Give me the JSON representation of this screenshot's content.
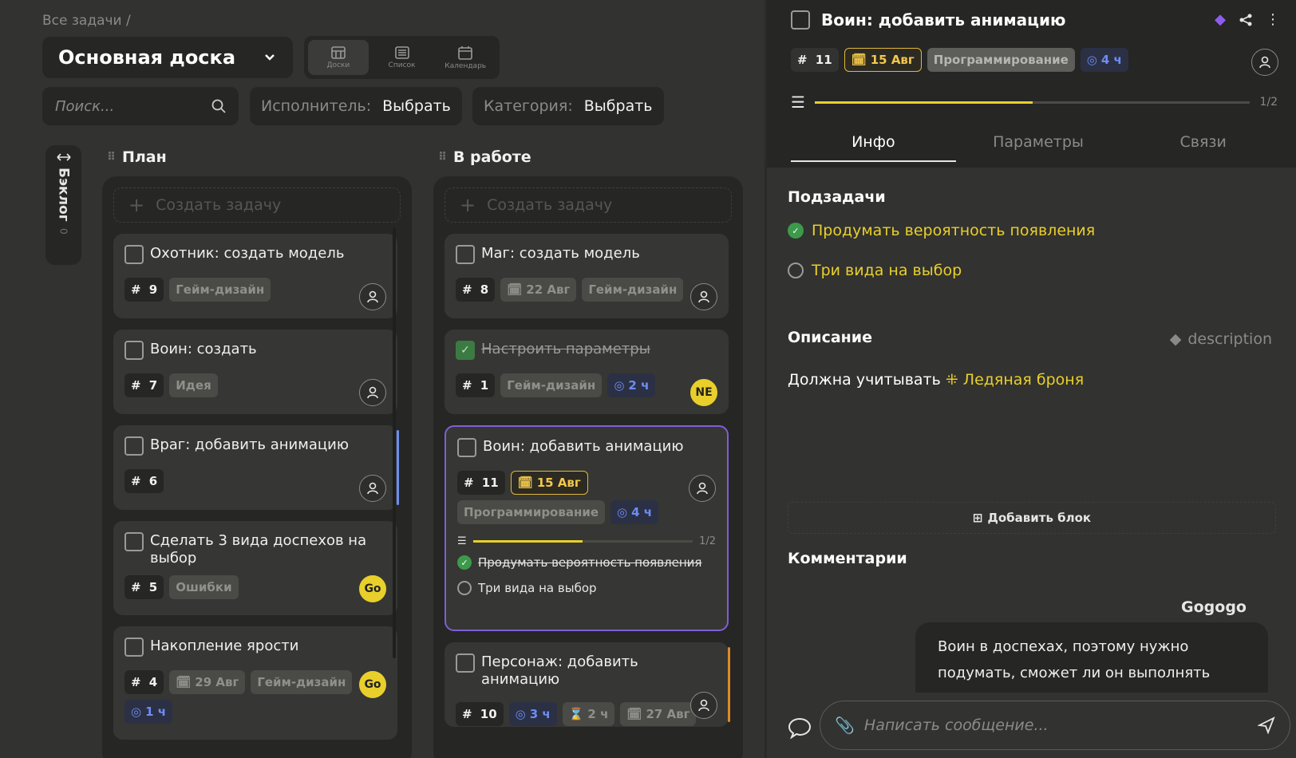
{
  "breadcrumb": "Все задачи /",
  "board": {
    "name": "Основная доска",
    "views": [
      {
        "label": "Доски",
        "icon": "board-icon",
        "active": true
      },
      {
        "label": "Список",
        "icon": "list-icon",
        "active": false
      },
      {
        "label": "Календарь",
        "icon": "calendar-icon",
        "active": false
      }
    ],
    "search_placeholder": "Поиск...",
    "filters": [
      {
        "key": "Исполнитель:",
        "value": "Выбрать"
      },
      {
        "key": "Категория:",
        "value": "Выбрать"
      }
    ],
    "backlog": {
      "label": "Бэклог",
      "count": "0"
    }
  },
  "columns": [
    {
      "title": "План",
      "create_label": "Создать задачу",
      "cards": [
        {
          "title": "Охотник: создать модель",
          "num": "9",
          "tags": [
            "Гейм-дизайн"
          ]
        },
        {
          "title": "Воин: создать",
          "num": "7",
          "tags": [
            "Идея"
          ]
        },
        {
          "title": "Враг: добавить анимацию",
          "num": "6",
          "tags": []
        },
        {
          "title": "Сделать 3 вида доспехов на выбор",
          "num": "5",
          "tags": [
            "Ошибки"
          ],
          "avatar": "Go"
        },
        {
          "title": "Накопление ярости",
          "num": "4",
          "date": "29 Авг",
          "tags": [
            "Гейм-дизайн"
          ],
          "time": "1 ч",
          "avatar": "Go"
        }
      ]
    },
    {
      "title": "В работе",
      "create_label": "Создать задачу",
      "cards": [
        {
          "title": "Маг: создать модель",
          "num": "8",
          "date": "22 Авг",
          "tags": [
            "Гейм-дизайн"
          ]
        },
        {
          "title": "Настроить параметры",
          "num": "1",
          "tags": [
            "Гейм-дизайн"
          ],
          "time": "2 ч",
          "avatar": "NE",
          "done": true
        },
        {
          "title": "Воин: добавить анимацию",
          "num": "11",
          "date": "15 Авг",
          "tags": [
            "Программирование"
          ],
          "time": "4 ч",
          "progress": "1/2",
          "subtasks": [
            {
              "text": "Продумать вероятность появления",
              "done": true
            },
            {
              "text": "Три вида на выбор",
              "done": false
            }
          ]
        },
        {
          "title": "Персонаж: добавить анимацию",
          "num": "10",
          "time": "3 ч",
          "hourglass": "2 ч",
          "date": "27 Авг",
          "tags": []
        }
      ]
    }
  ],
  "detail": {
    "title": "Воин: добавить анимацию",
    "num": "11",
    "date": "15 Авг",
    "category": "Программирование",
    "time": "4 ч",
    "progress_label": "1/2",
    "progress_value": 0.5,
    "tabs": [
      "Инфо",
      "Параметры",
      "Связи"
    ],
    "subtasks_title": "Подзадачи",
    "subtasks": [
      {
        "text": "Продумать вероятность появления",
        "done": true
      },
      {
        "text": "Три вида на выбор",
        "done": false
      }
    ],
    "description_title": "Описание",
    "description_tag": "description",
    "description_text": "Должна учитывать",
    "description_link": "Ледяная броня",
    "add_block": "Добавить блок",
    "comments_title": "Комментарии",
    "comment_author": "Gogogo",
    "comment_text": "Воин в доспехах, поэтому нужно подумать, сможет ли он выполнять",
    "message_placeholder": "Написать сообщение..."
  },
  "colors": {
    "accent": "#e9cf2b",
    "selection": "#7f5fd6",
    "time": "#6d8df2",
    "done": "#3c9a4a"
  }
}
